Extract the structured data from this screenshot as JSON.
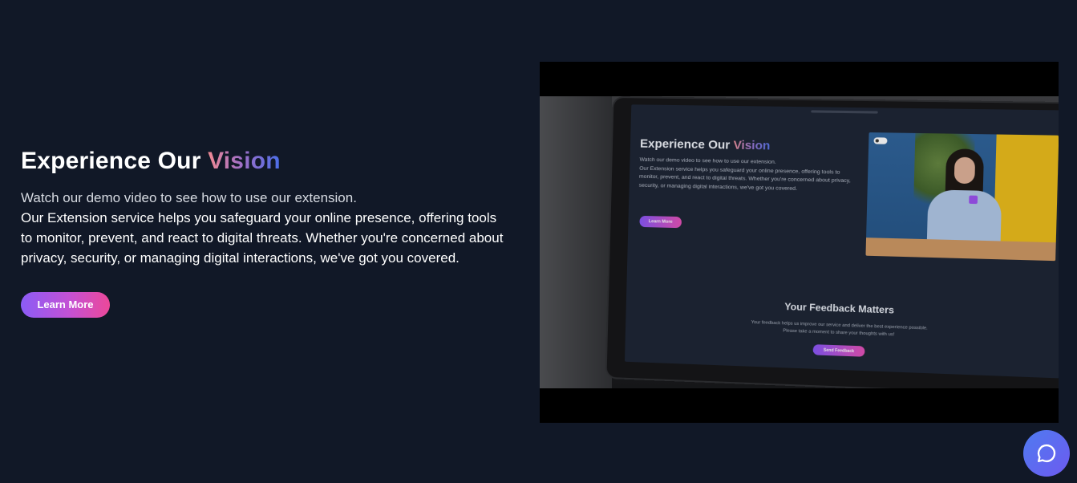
{
  "hero": {
    "title_plain": "Experience Our ",
    "title_accent": "Vision",
    "intro": "Watch our demo video to see how to use our extension.",
    "description": "Our Extension service helps you safeguard your online presence, offering tools to monitor, prevent, and react to digital threats. Whether you're concerned about privacy, security, or managing digital interactions, we've got you covered.",
    "cta_label": "Learn More",
    "accent_gradient": [
      "#f08a93",
      "#a26fc6",
      "#4a6ee8"
    ],
    "button_gradient": [
      "#8b5cf6",
      "#c451d4",
      "#ec4899"
    ]
  },
  "video": {
    "frame": {
      "title_plain": "Experience Our ",
      "title_accent": "Vision",
      "intro": "Watch our demo video to see how to use our extension.",
      "description": "Our Extension service helps you safeguard your online presence, offering tools to monitor, prevent, and react to digital threats. Whether you're concerned about privacy, security, or managing digital interactions, we've got you covered.",
      "cta_label": "Learn More",
      "feedback_title": "Your Feedback Matters",
      "feedback_body": "Your feedback helps us improve our service and deliver the best experience possible. Please take a moment to share your thoughts with us!",
      "feedback_button": "Send Feedback"
    }
  },
  "chat": {
    "icon": "chat-bubble-icon",
    "color": "#5b6cf2"
  },
  "colors": {
    "background": "#111827",
    "video_letterbox": "#000000"
  }
}
